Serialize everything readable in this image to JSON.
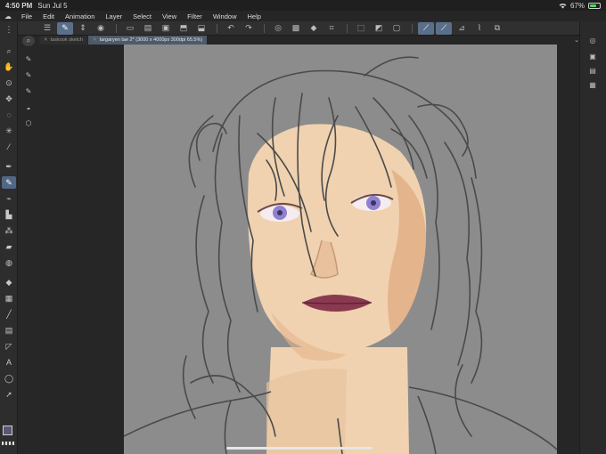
{
  "status_bar": {
    "time": "4:50 PM",
    "date": "Sun Jul 5",
    "battery_percent": "67%",
    "battery_level": 0.67,
    "icons": [
      "wifi-icon",
      "battery-icon"
    ]
  },
  "menu": {
    "items": [
      "File",
      "Edit",
      "Animation",
      "Layer",
      "Select",
      "View",
      "Filter",
      "Window",
      "Help"
    ]
  },
  "tabs": [
    {
      "label": "taskook sketch",
      "active": false
    },
    {
      "label": "targaryen tae 2* (3000 x 4000px 300dpi 65.5%)",
      "active": true
    }
  ],
  "colors": {
    "canvas_bg": "#8c8c8c",
    "skin": "#f0d2b0",
    "skin_shadow": "#e4b48c",
    "iris": "#9080d0",
    "lips": "#8a3a50",
    "line": "#4a4a4a",
    "main_color": "#5a5774",
    "accent": "#526785"
  }
}
